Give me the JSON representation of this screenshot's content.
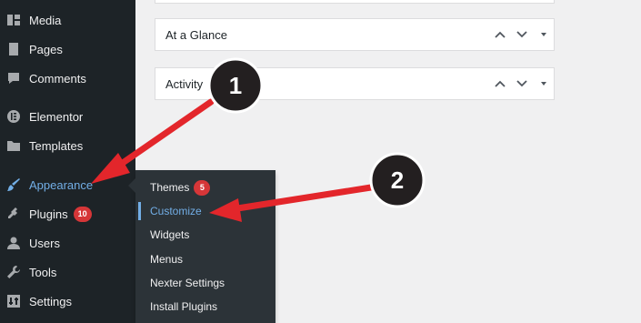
{
  "sidebar": {
    "items": [
      {
        "label": "Media",
        "icon": "media-icon"
      },
      {
        "label": "Pages",
        "icon": "pages-icon"
      },
      {
        "label": "Comments",
        "icon": "comments-icon"
      },
      {
        "label": "Elementor",
        "icon": "elementor-icon"
      },
      {
        "label": "Templates",
        "icon": "folder-icon"
      },
      {
        "label": "Appearance",
        "icon": "brush-icon",
        "active": true
      },
      {
        "label": "Plugins",
        "icon": "plugin-icon",
        "badge": "10"
      },
      {
        "label": "Users",
        "icon": "user-icon"
      },
      {
        "label": "Tools",
        "icon": "wrench-icon"
      },
      {
        "label": "Settings",
        "icon": "settings-icon"
      }
    ]
  },
  "submenu": {
    "items": [
      {
        "label": "Themes",
        "badge": "5"
      },
      {
        "label": "Customize",
        "current": true
      },
      {
        "label": "Widgets"
      },
      {
        "label": "Menus"
      },
      {
        "label": "Nexter Settings"
      },
      {
        "label": "Install Plugins"
      }
    ]
  },
  "widgets": [
    {
      "title": "At a Glance"
    },
    {
      "title": "Activity"
    }
  ],
  "annotations": {
    "step1": "1",
    "step2": "2"
  },
  "colors": {
    "sidebar_bg": "#1d2327",
    "submenu_bg": "#2c3338",
    "accent": "#72aee6",
    "badge": "#d63638",
    "arrow": "#e3262b",
    "step_circle": "#231f20"
  }
}
